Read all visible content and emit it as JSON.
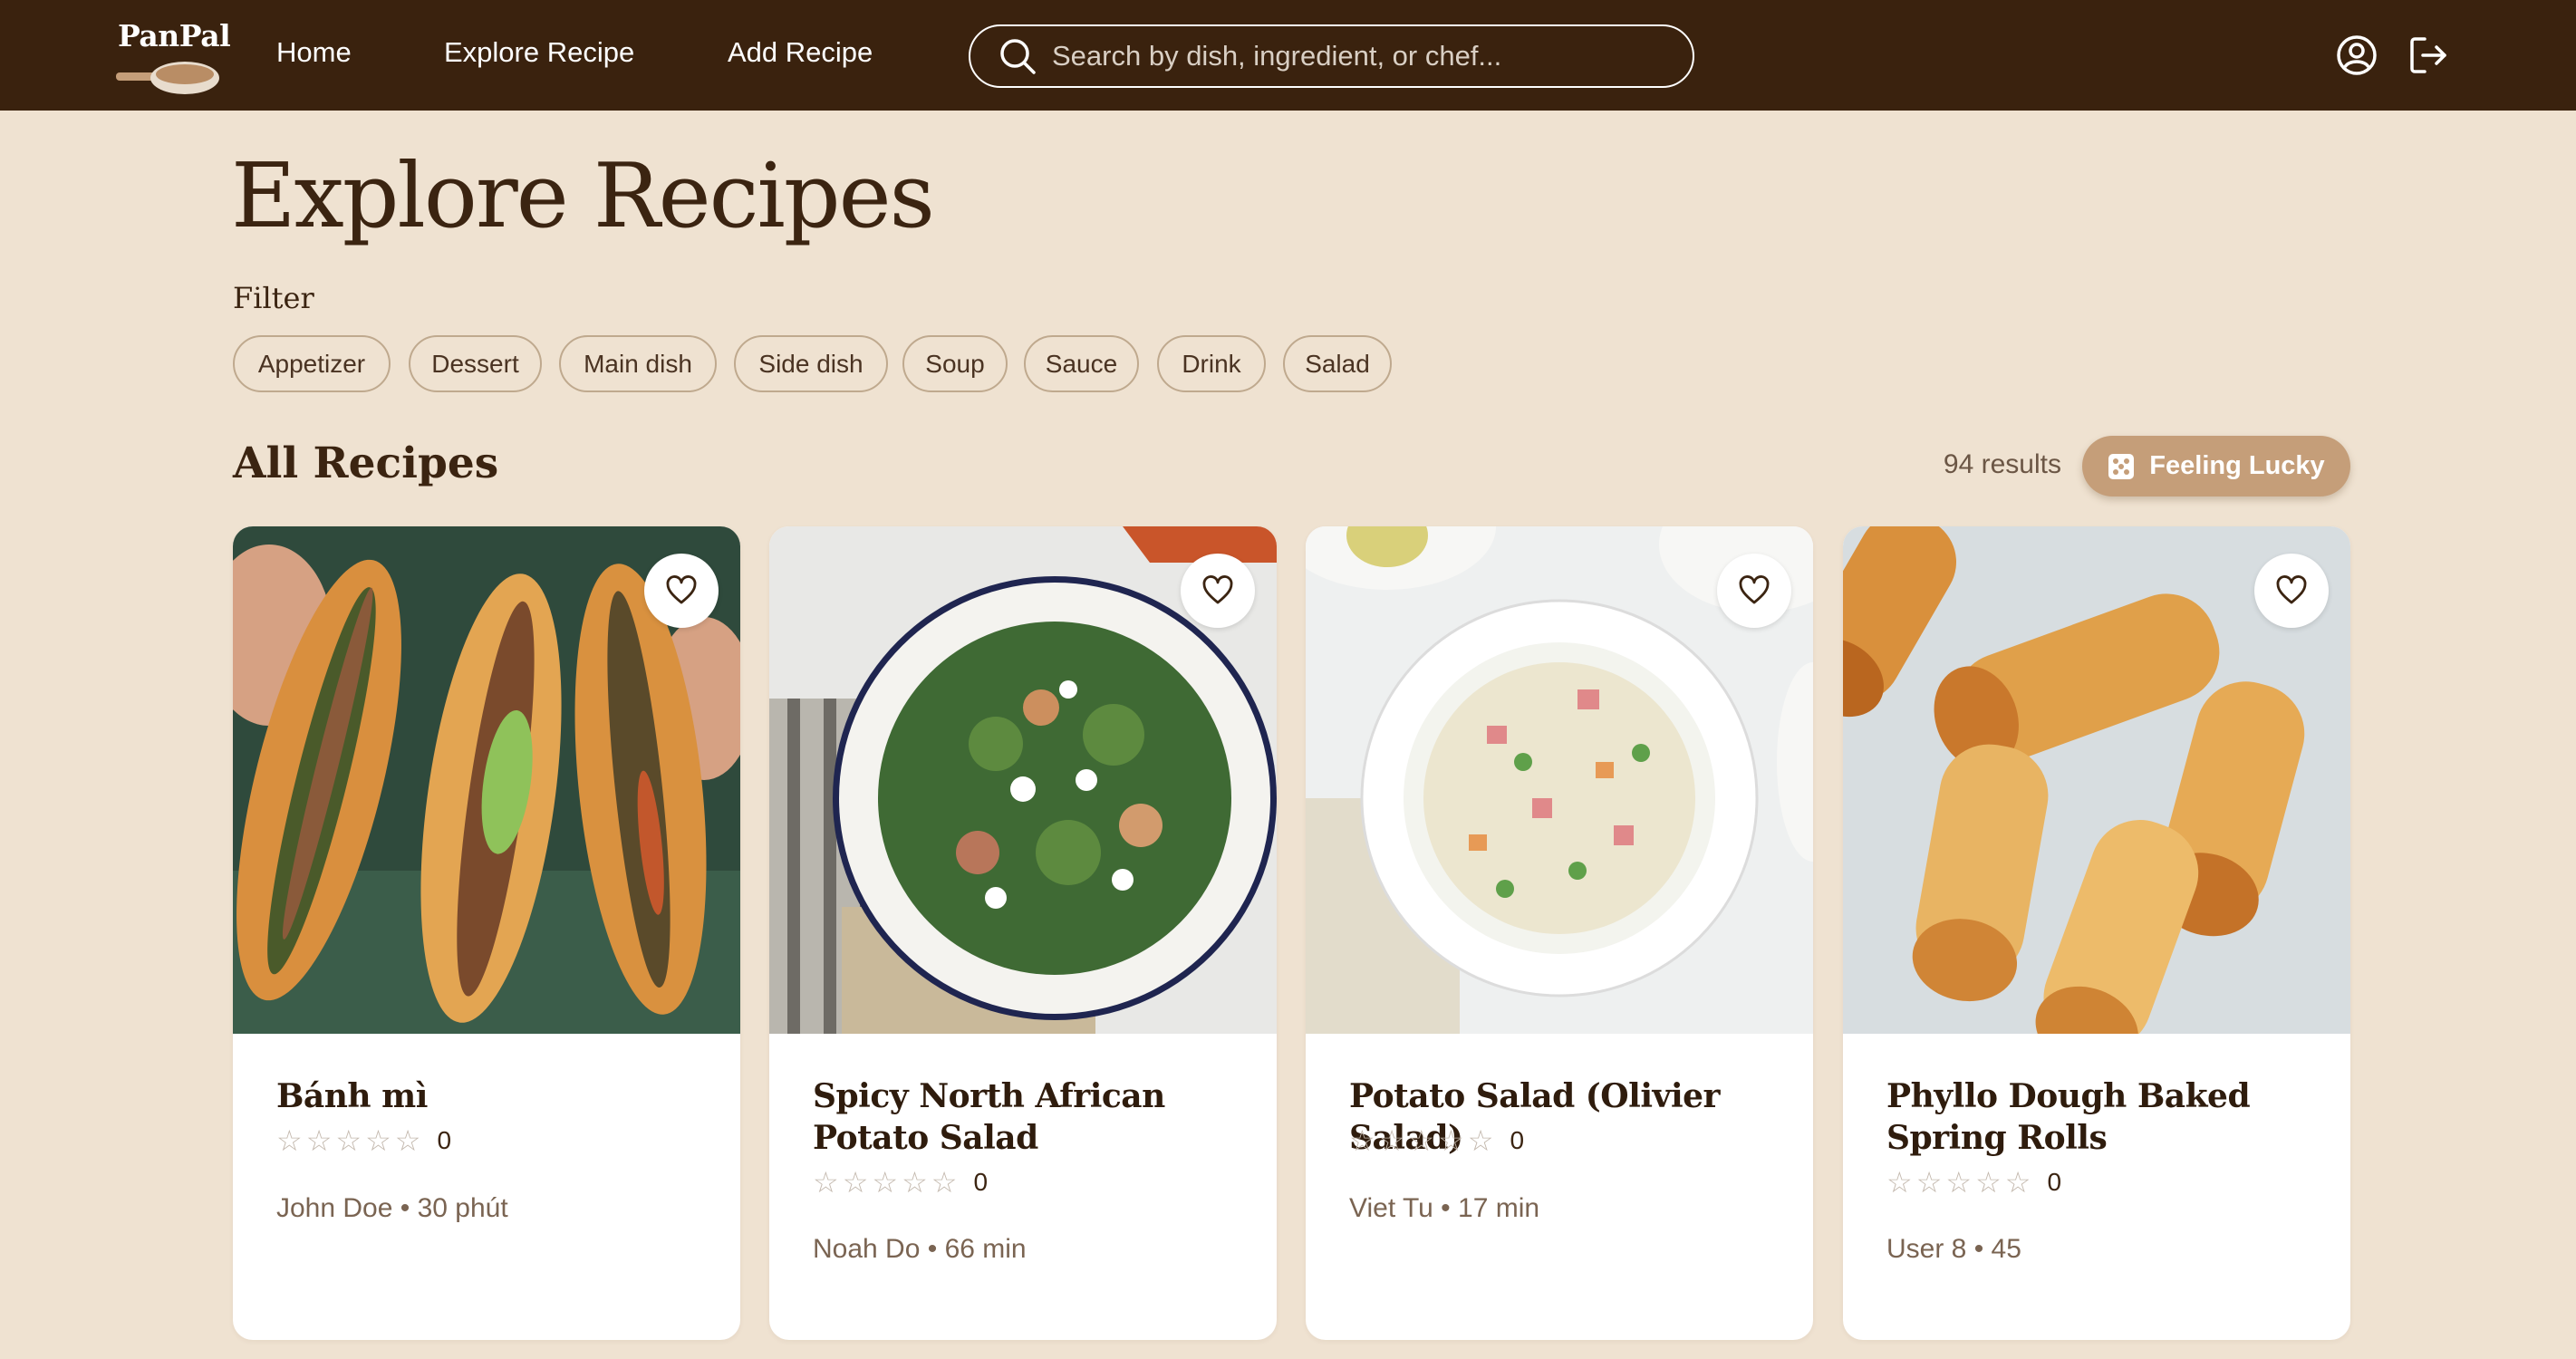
{
  "nav": {
    "logo_text": "PanPal",
    "links": [
      "Home",
      "Explore Recipe",
      "Add Recipe"
    ],
    "search_placeholder": "Search by dish, ingredient, or chef...",
    "icons": [
      "user-circle-icon",
      "logout-icon"
    ]
  },
  "page": {
    "title": "Explore Recipes",
    "filter_label": "Filter",
    "filters": [
      "Appetizer",
      "Dessert",
      "Main dish",
      "Side dish",
      "Soup",
      "Sauce",
      "Drink",
      "Salad"
    ],
    "section_title": "All Recipes",
    "results": "94 results",
    "lucky_label": "Feeling Lucky"
  },
  "recipes": [
    {
      "title": "Bánh mì",
      "rating_count": "0",
      "meta": "John Doe • 30 phút",
      "rating_stars": 0
    },
    {
      "title": "Spicy North African Potato Salad",
      "rating_count": "0",
      "meta": "Noah Do • 66 min",
      "rating_stars": 0
    },
    {
      "title": "Potato Salad (Olivier Salad)",
      "rating_count": "0",
      "meta": "Viet Tu • 17 min",
      "rating_stars": 0
    },
    {
      "title": "Phyllo Dough Baked Spring Rolls",
      "rating_count": "0",
      "meta": "User 8 • 45",
      "rating_stars": 0
    }
  ],
  "colors": {
    "navbar": "#3a220e",
    "background": "#efe2d1",
    "accent": "#c59e79",
    "text_dark": "#3b2411"
  }
}
